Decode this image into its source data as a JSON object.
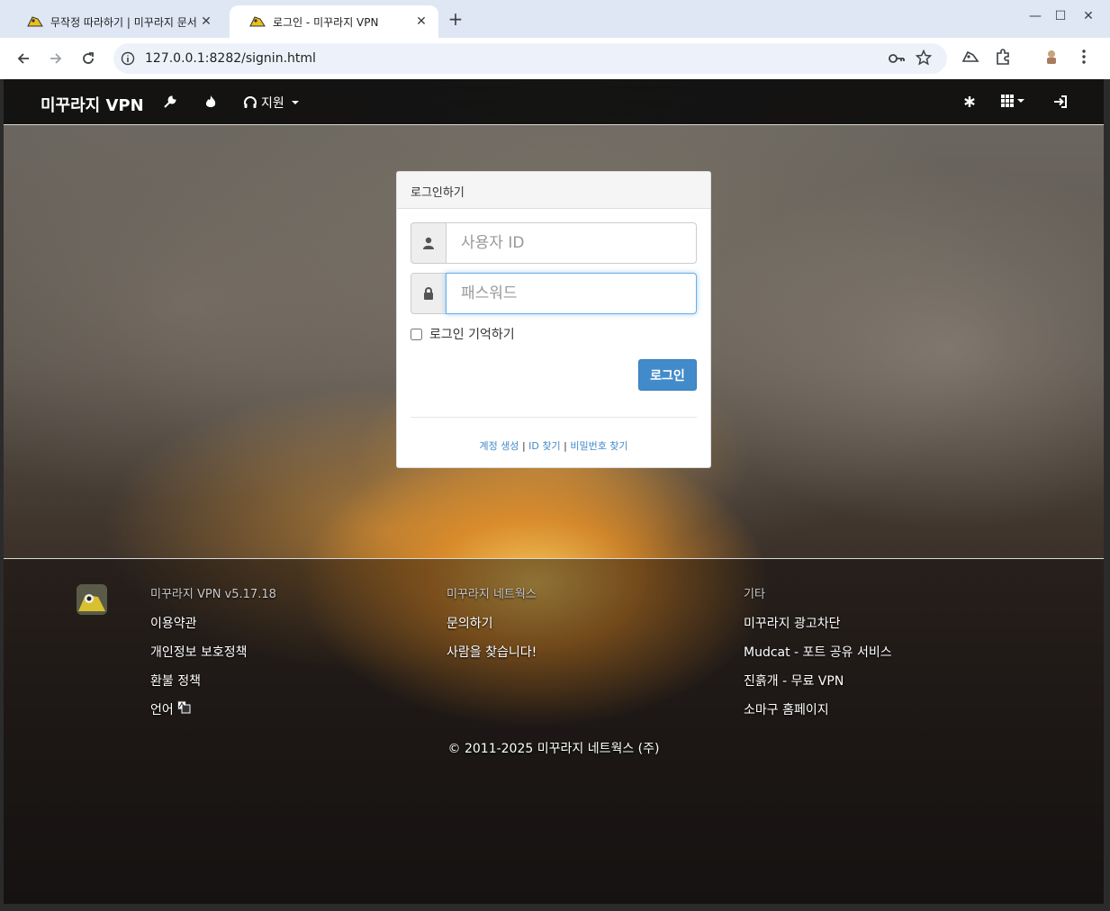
{
  "browser": {
    "tabs": [
      {
        "title": "무작정 따라하기 | 미꾸라지 문서",
        "active": false
      },
      {
        "title": "로그인 - 미꾸라지 VPN",
        "active": true
      }
    ],
    "url": "127.0.0.1:8282/signin.html"
  },
  "nav": {
    "brand": "미꾸라지 VPN",
    "support_label": "지원"
  },
  "login": {
    "heading": "로그인하기",
    "username_placeholder": "사용자 ID",
    "password_placeholder": "패스워드",
    "remember_label": "로그인 기억하기",
    "submit_label": "로그인",
    "links": {
      "create_account": "계정 생성",
      "find_id": "ID 찾기",
      "find_password": "비밀번호 찾기",
      "separator": "|"
    }
  },
  "footer": {
    "col1": {
      "heading": "미꾸라지 VPN v5.17.18",
      "items": [
        "이용약관",
        "개인정보 보호정책",
        "환불 정책",
        "언어"
      ]
    },
    "col2": {
      "heading": "미꾸라지 네트웍스",
      "items": [
        "문의하기",
        "사람을 찾습니다!"
      ]
    },
    "col3": {
      "heading": "기타",
      "items": [
        "미꾸라지 광고차단",
        "Mudcat - 포트 공유 서비스",
        "진흙개 - 무료 VPN",
        "소마구 홈페이지"
      ]
    },
    "copyright": "© 2011-2025 미꾸라지 네트웍스 (주)"
  },
  "colors": {
    "primary": "#428bca",
    "navbar": "#0a0a0a",
    "tabstrip": "#dfe7f5"
  }
}
